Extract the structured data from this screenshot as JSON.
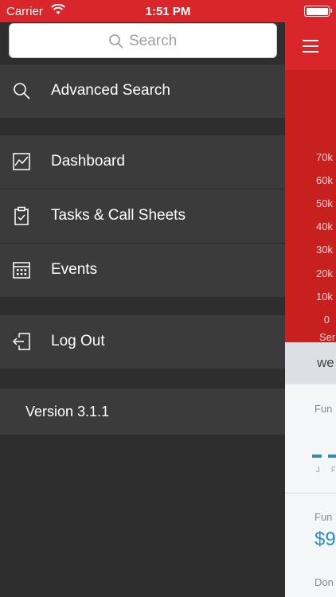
{
  "status_bar": {
    "carrier": "Carrier",
    "time": "1:51 PM",
    "battery_level": 1.0
  },
  "drawer": {
    "search": {
      "placeholder": "Search"
    },
    "items": [
      {
        "label": "Advanced Search",
        "icon": "search-icon"
      },
      {
        "label": "Dashboard",
        "icon": "chart-icon"
      },
      {
        "label": "Tasks & Call Sheets",
        "icon": "clipboard-check-icon"
      },
      {
        "label": "Events",
        "icon": "calendar-icon"
      },
      {
        "label": "Log Out",
        "icon": "log-out-icon"
      }
    ],
    "version": "Version 3.1.1"
  },
  "background": {
    "chart": {
      "y_ticks": [
        "70k",
        "60k",
        "50k",
        "40k",
        "30k",
        "20k",
        "10k",
        "0"
      ],
      "x_label_partial": "Ser"
    },
    "week_label": "we",
    "card1": {
      "label_partial": "Fun",
      "months_partial": [
        "J",
        "F"
      ]
    },
    "card2": {
      "label_partial": "Fun",
      "value_partial": "$9",
      "sub_partial": "Don"
    },
    "colors": {
      "accent_red": "#d8262a",
      "accent_blue": "#2e8bc0",
      "drawer_bg": "#3b3b3b"
    }
  }
}
